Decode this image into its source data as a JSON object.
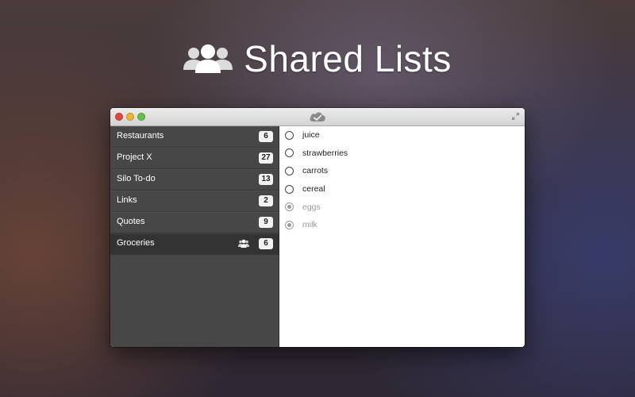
{
  "headline": {
    "title": "Shared Lists",
    "icon": "people-group-icon"
  },
  "window": {
    "buttons": [
      "close",
      "minimize",
      "maximize"
    ],
    "title_icon": "cloud-check-icon",
    "fullscreen_icon": "fullscreen-arrows-icon"
  },
  "sidebar": {
    "items": [
      {
        "label": "Restaurants",
        "count": "6",
        "selected": false,
        "shared": false
      },
      {
        "label": "Project X",
        "count": "27",
        "selected": false,
        "shared": false
      },
      {
        "label": "Silo To-do",
        "count": "13",
        "selected": false,
        "shared": false
      },
      {
        "label": "Links",
        "count": "2",
        "selected": false,
        "shared": false
      },
      {
        "label": "Quotes",
        "count": "9",
        "selected": false,
        "shared": false
      },
      {
        "label": "Groceries",
        "count": "6",
        "selected": true,
        "shared": true
      }
    ]
  },
  "tasks": [
    {
      "text": "juice",
      "done": false
    },
    {
      "text": "strawberries",
      "done": false
    },
    {
      "text": "carrots",
      "done": false
    },
    {
      "text": "cereal",
      "done": false
    },
    {
      "text": "eggs",
      "done": true
    },
    {
      "text": "milk",
      "done": true
    }
  ],
  "colors": {
    "sidebar_bg": "#474747",
    "sidebar_selected": "#333333",
    "close": "#e0493f",
    "minimize": "#e9b43a",
    "maximize": "#67bf48"
  }
}
